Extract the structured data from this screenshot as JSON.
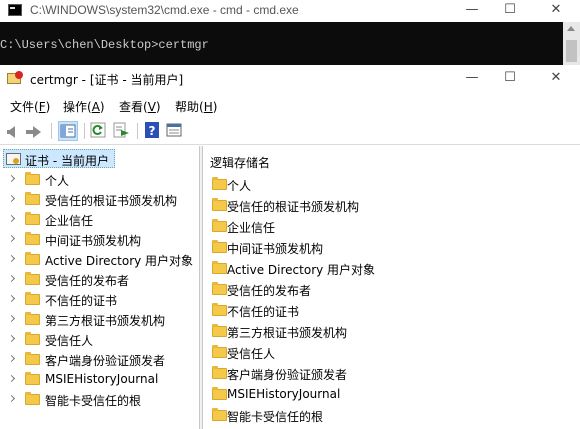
{
  "cmd": {
    "title": "C:\\WINDOWS\\system32\\cmd.exe - cmd - cmd.exe",
    "line": "C:\\Users\\chen\\Desktop>certmgr",
    "buttons": {
      "minimize": "—",
      "maximize": "☐",
      "close": "✕"
    }
  },
  "certmgr": {
    "title": "certmgr - [证书 - 当前用户]",
    "menu": [
      {
        "label": "文件(",
        "key": "F",
        "tail": ")"
      },
      {
        "label": "操作(",
        "key": "A",
        "tail": ")"
      },
      {
        "label": "查看(",
        "key": "V",
        "tail": ")"
      },
      {
        "label": "帮助(",
        "key": "H",
        "tail": ")"
      }
    ],
    "tree": {
      "root": "证书 - 当前用户",
      "items": [
        "个人",
        "受信任的根证书颁发机构",
        "企业信任",
        "中间证书颁发机构",
        "Active Directory 用户对象",
        "受信任的发布者",
        "不信任的证书",
        "第三方根证书颁发机构",
        "受信任人",
        "客户端身份验证颁发者",
        "MSIEHistoryJournal",
        "智能卡受信任的根"
      ]
    },
    "list": {
      "header": "逻辑存储名",
      "items": [
        "个人",
        "受信任的根证书颁发机构",
        "企业信任",
        "中间证书颁发机构",
        "Active Directory 用户对象",
        "受信任的发布者",
        "不信任的证书",
        "第三方根证书颁发机构",
        "受信任人",
        "客户端身份验证颁发者",
        "MSIEHistoryJournal",
        "智能卡受信任的根"
      ]
    }
  }
}
